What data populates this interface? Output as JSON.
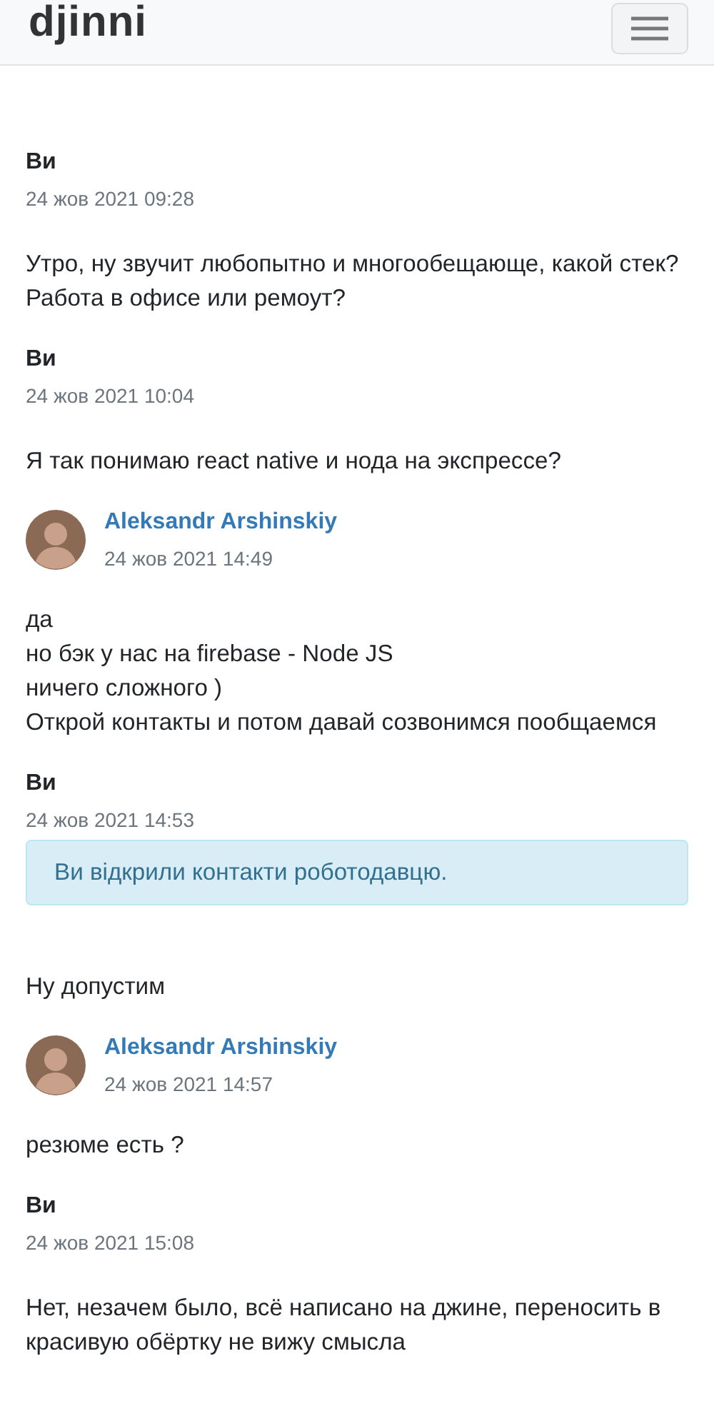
{
  "header": {
    "logo": "djinni"
  },
  "messages": [
    {
      "kind": "me",
      "author": "Ви",
      "time": "24 жов 2021 09:28",
      "lines": [
        "Утро, ну звучит любопытно и многообещающе, какой стек? Работа в офисе или ремоут?"
      ]
    },
    {
      "kind": "me",
      "author": "Ви",
      "time": "24 жов 2021 10:04",
      "lines": [
        "Я так понимаю react native и нода на экспрессе?"
      ]
    },
    {
      "kind": "contact",
      "author": "Aleksandr Arshinskiy",
      "time": "24 жов 2021 14:49",
      "lines": [
        "да",
        "но бэк у нас на firebase - Node JS",
        "ничего сложного )",
        "Открой контакты и потом давай созвонимся пообщаемся"
      ]
    },
    {
      "kind": "me",
      "author": "Ви",
      "time": "24 жов 2021 14:53",
      "notice": "Ви відкрили контакти роботодавцю.",
      "lines": [
        "Ну допустим"
      ]
    },
    {
      "kind": "contact",
      "author": "Aleksandr Arshinskiy",
      "time": "24 жов 2021 14:57",
      "lines": [
        "резюме есть ?"
      ]
    },
    {
      "kind": "me",
      "author": "Ви",
      "time": "24 жов 2021 15:08",
      "lines": [
        "Нет, незачем было, всё написано на джине, переносить в красивую обёртку не вижу смысла"
      ]
    }
  ]
}
